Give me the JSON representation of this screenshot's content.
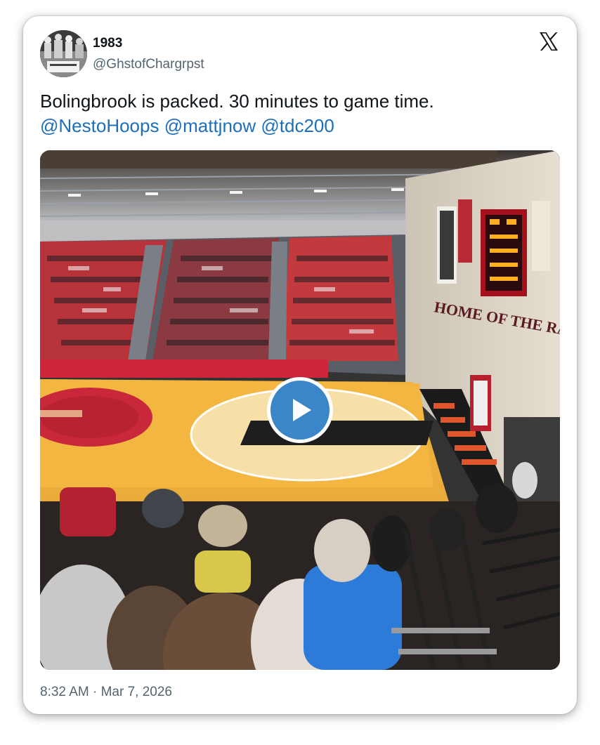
{
  "tweet": {
    "display_name": "1983",
    "handle": "@GhstofChargrpst",
    "text": "Bolingbrook is packed. 30 minutes to game time.",
    "mentions": [
      "@NestoHoops",
      "@mattjnow",
      "@tdc200"
    ],
    "timestamp": "8:32 AM · Mar 7, 2026",
    "scoreboard_text": "HOME OF THE RAIDERS"
  },
  "icons": {
    "logo": "x-logo-icon",
    "play": "play-icon",
    "avatar": "avatar-photo"
  },
  "colors": {
    "mention": "#1d6fb8",
    "play_button": "#3a86c8",
    "text": "#0f1419",
    "secondary": "#536471"
  }
}
